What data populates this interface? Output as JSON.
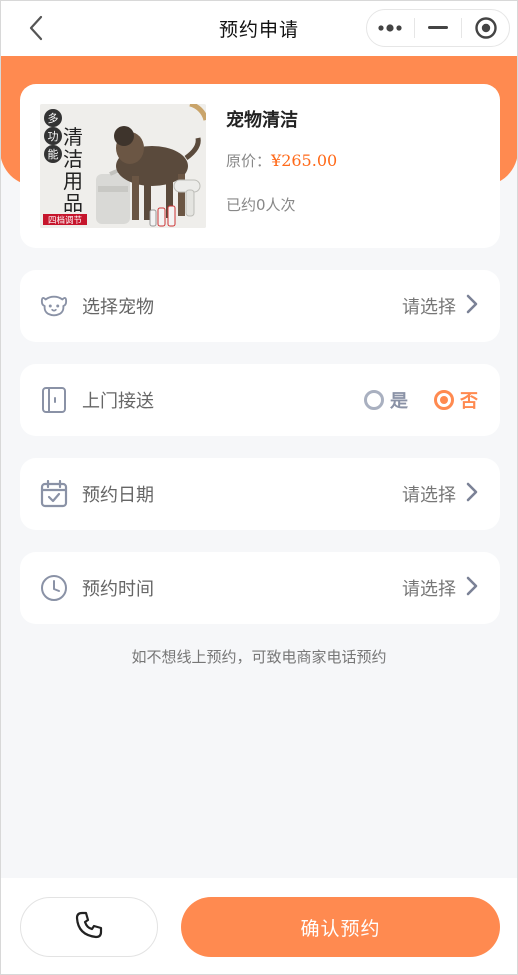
{
  "nav": {
    "title": "预约申请",
    "back_icon": "chevron-left-icon",
    "capsule": [
      "more-dots-icon",
      "minimize-icon",
      "target-close-icon"
    ]
  },
  "colors": {
    "accent": "#ff8a50",
    "price": "#ff6a1a",
    "background": "#f6f7f9"
  },
  "product": {
    "name": "宠物清洁",
    "price_label": "原价：",
    "price": "¥265.00",
    "booked": "已约0人次",
    "image_text": {
      "badge": "多功能",
      "vertical": "清洁用品",
      "tag": "四档调节"
    }
  },
  "rows": {
    "pet": {
      "label": "选择宠物",
      "value": "请选择",
      "icon": "pet-face-icon"
    },
    "pickup": {
      "label": "上门接送",
      "icon": "door-icon",
      "options": [
        {
          "label": "是",
          "selected": false
        },
        {
          "label": "否",
          "selected": true
        }
      ]
    },
    "date": {
      "label": "预约日期",
      "value": "请选择",
      "icon": "calendar-check-icon"
    },
    "time": {
      "label": "预约时间",
      "value": "请选择",
      "icon": "clock-icon"
    }
  },
  "hint": "如不想线上预约，可致电商家电话预约",
  "bottom": {
    "call_icon": "phone-icon",
    "confirm_label": "确认预约"
  }
}
